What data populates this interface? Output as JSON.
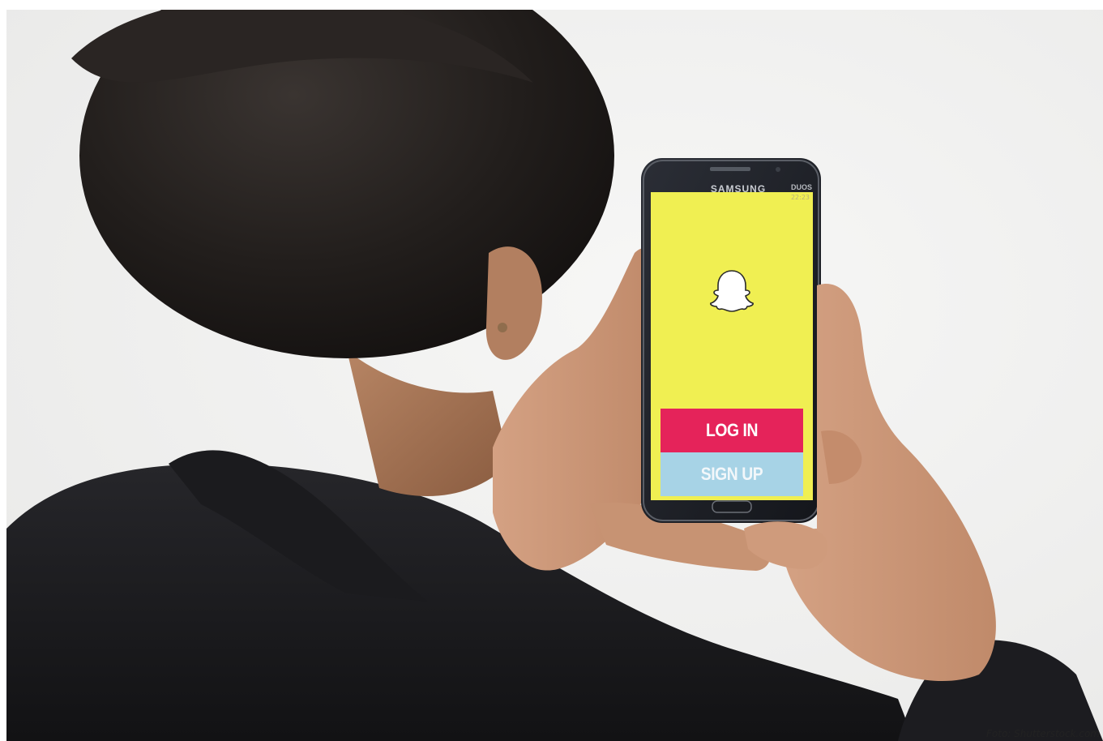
{
  "phone": {
    "brand": "SAMSUNG",
    "model_badge": "DUOS",
    "status_time": "22:23",
    "app": {
      "logo_icon": "snapchat-ghost-icon",
      "login_label": "LOG IN",
      "signup_label": "SIGN UP",
      "colors": {
        "background": "#f0ef52",
        "login": "#e5235a",
        "signup": "#a7d3e6"
      }
    }
  },
  "caption": "Foto: Shutterstock.com"
}
